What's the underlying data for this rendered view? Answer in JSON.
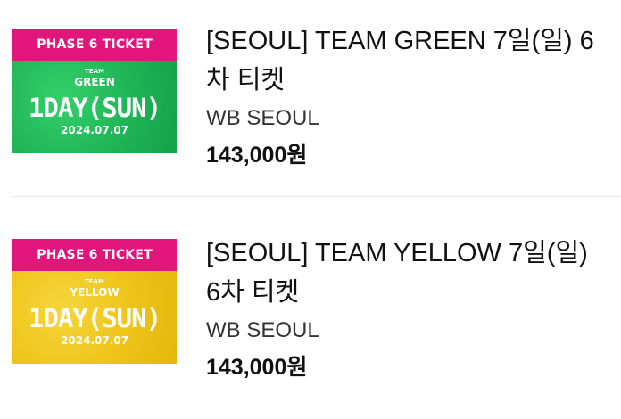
{
  "products": [
    {
      "thumb_header": "PHASE 6 TICKET",
      "thumb_team": "TEAM",
      "thumb_team_name": "GREEN",
      "thumb_day": "1DAY(SUN)",
      "thumb_date": "2024.07.07",
      "title": "[SEOUL] TEAM GREEN 7일(일) 6차 티켓",
      "venue": "WB SEOUL",
      "price": "143,000원",
      "color": "#1fb456"
    },
    {
      "thumb_header": "PHASE 6 TICKET",
      "thumb_team": "TEAM",
      "thumb_team_name": "YELLOW",
      "thumb_day": "1DAY(SUN)",
      "thumb_date": "2024.07.07",
      "title": "[SEOUL] TEAM YELLOW 7일(일) 6차 티켓",
      "venue": "WB SEOUL",
      "price": "143,000원",
      "color": "#eec41a"
    }
  ],
  "colors": {
    "header_pink": "#e0167c"
  }
}
